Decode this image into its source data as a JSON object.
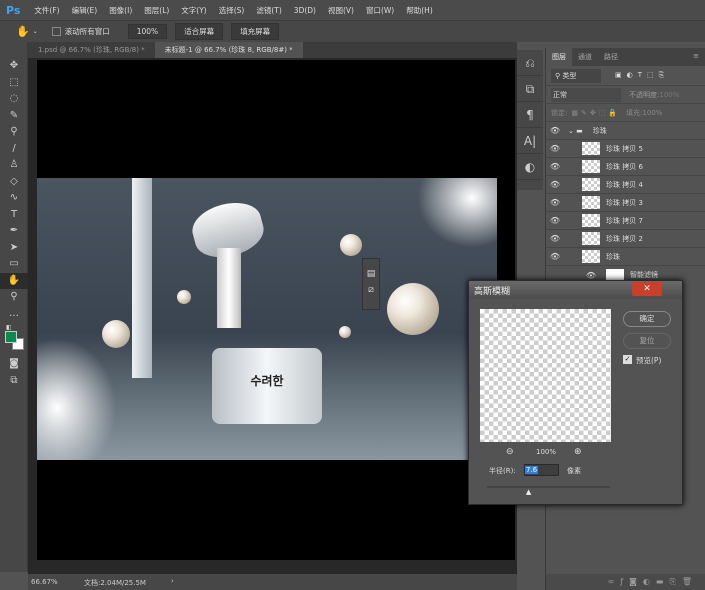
{
  "app": {
    "logo": "Ps"
  },
  "menu": [
    "文件(F)",
    "编辑(E)",
    "图像(I)",
    "图层(L)",
    "文字(Y)",
    "选择(S)",
    "滤镜(T)",
    "3D(D)",
    "视图(V)",
    "窗口(W)",
    "帮助(H)"
  ],
  "options": {
    "scroll_all": "滚动所有窗口",
    "zoom": "100%",
    "fit_screen": "适合屏幕",
    "fill_screen": "填充屏幕"
  },
  "tabs": [
    {
      "label": "1.psd @ 66.7% (珍珠, RGB/8) *",
      "active": false
    },
    {
      "label": "未标题-1 @ 66.7% (珍珠 8, RGB/8#) *",
      "active": true
    }
  ],
  "status": {
    "zoom": "66.67%",
    "doc": "文档:2.04M/25.5M"
  },
  "colors": {
    "foreground": "#0a8a4e",
    "background": "#ffffff"
  },
  "layers_panel": {
    "tabs": [
      "图层",
      "通道",
      "路径"
    ],
    "filter_placeholder": "类型",
    "blend_mode": "正常",
    "opacity_label": "不透明度:",
    "opacity": "100%",
    "lock_label": "锁定:",
    "fill_label": "填充:",
    "fill": "100%",
    "group": "珍珠",
    "layers": [
      "珍珠 拷贝 5",
      "珍珠 拷贝 6",
      "珍珠 拷贝 4",
      "珍珠 拷贝 3",
      "珍珠 拷贝 7",
      "珍珠 拷贝 2",
      "珍珠"
    ],
    "smart_filter": "智能滤镜"
  },
  "dialog": {
    "title": "高斯模糊",
    "ok": "确定",
    "reset": "复位",
    "preview_label": "预览(P)",
    "preview_checked": true,
    "zoom": "100%",
    "radius_label": "半径(R):",
    "radius": "7.6",
    "unit": "像素",
    "slider_fraction": 0.34
  },
  "photo": {
    "brand": "수려한"
  }
}
